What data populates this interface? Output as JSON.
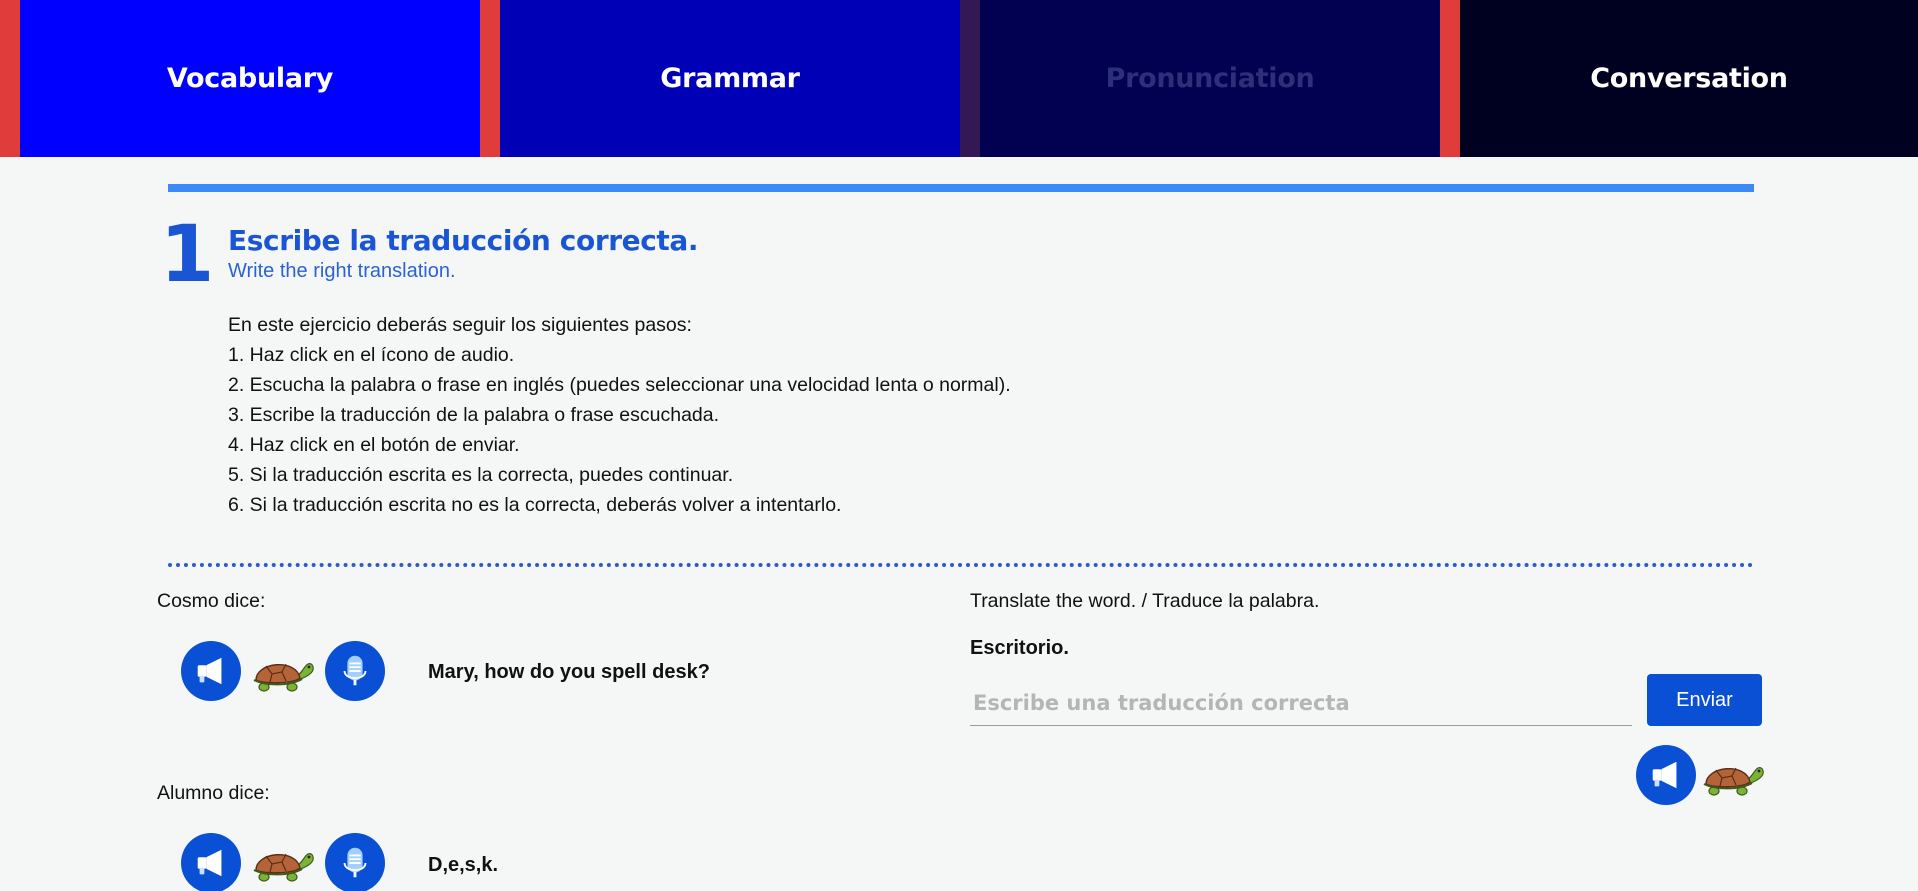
{
  "tabs": [
    {
      "label": "Vocabulary"
    },
    {
      "label": "Grammar"
    },
    {
      "label": "Pronunciation"
    },
    {
      "label": "Conversation"
    }
  ],
  "exercise": {
    "number": "1",
    "title": "Escribe la traducción correcta.",
    "subtitle": "Write the right translation.",
    "instructions": [
      "En este ejercicio deberás seguir los siguientes pasos:",
      "1. Haz click en el ícono de audio.",
      "2. Escucha la palabra o frase en inglés (puedes seleccionar una velocidad lenta o normal).",
      "3. Escribe la traducción de la palabra o frase escuchada.",
      "4. Haz click en el botón de enviar.",
      "5. Si la traducción escrita es la correcta, puedes continuar.",
      "6. Si la traducción escrita no es la correcta, deberás volver a intentarlo."
    ]
  },
  "dialogue": {
    "cosmo_label": "Cosmo dice:",
    "cosmo_phrase": "Mary, how do you spell desk?",
    "alumno_label": "Alumno dice:",
    "alumno_phrase": "D,e,s,k."
  },
  "task": {
    "prompt": "Translate the word. / Traduce la palabra.",
    "word": "Escritorio.",
    "input_value": "",
    "input_placeholder": "Escribe una traducción correcta",
    "send_label": "Enviar"
  },
  "icons": {
    "audio": "megaphone-icon",
    "slow": "turtle-icon",
    "record": "microphone-icon"
  },
  "colors": {
    "accent": "#0950d4",
    "title_blue": "#1a56d3",
    "tab_vocabulary": "#0000fe",
    "tab_grammar": "#0000b7",
    "tab_pronunciation": "#010051",
    "tab_conversation": "#000020",
    "tab_separator": "#e03c3c"
  }
}
